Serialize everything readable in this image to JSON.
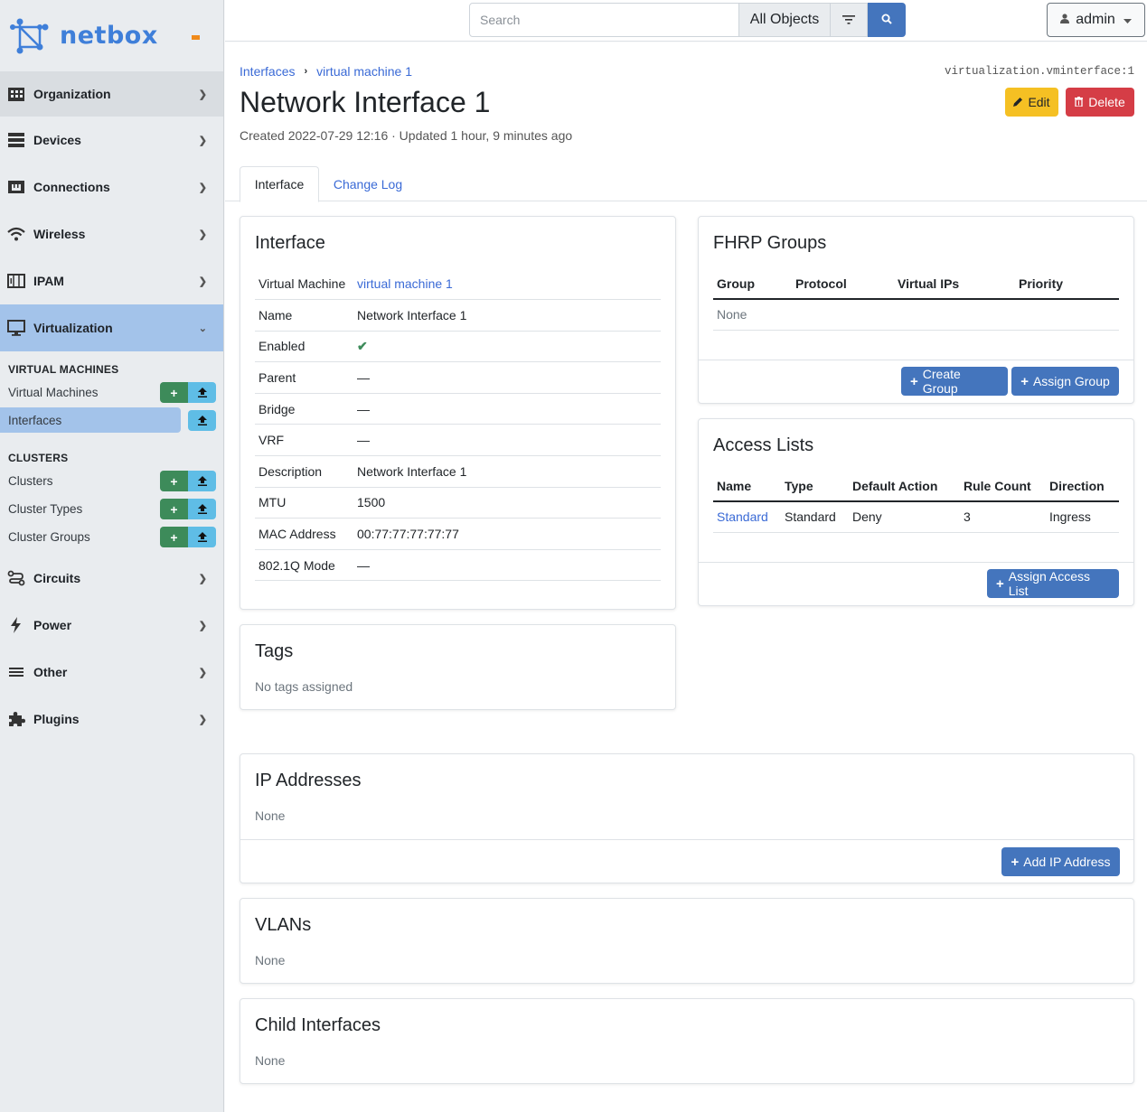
{
  "brand": {
    "name": "netbox"
  },
  "sidebar": {
    "sections_top": [
      {
        "label": "Organization",
        "icon": "building-icon"
      },
      {
        "label": "Devices",
        "icon": "server-icon"
      },
      {
        "label": "Connections",
        "icon": "ethernet-icon"
      },
      {
        "label": "Wireless",
        "icon": "wifi-icon"
      },
      {
        "label": "IPAM",
        "icon": "counter-icon"
      },
      {
        "label": "Virtualization",
        "icon": "monitor-icon"
      }
    ],
    "vm_heading": "VIRTUAL MACHINES",
    "vm_items": [
      {
        "label": "Virtual Machines"
      },
      {
        "label": "Interfaces"
      }
    ],
    "cluster_heading": "CLUSTERS",
    "cluster_items": [
      {
        "label": "Clusters"
      },
      {
        "label": "Cluster Types"
      },
      {
        "label": "Cluster Groups"
      }
    ],
    "sections_bottom": [
      {
        "label": "Circuits",
        "icon": "transit-icon"
      },
      {
        "label": "Power",
        "icon": "flash-icon"
      },
      {
        "label": "Other",
        "icon": "menu-icon"
      },
      {
        "label": "Plugins",
        "icon": "puzzle-icon"
      }
    ],
    "add_symbol": "+",
    "import_symbol": "⇪"
  },
  "topbar": {
    "search_placeholder": "Search",
    "object_selector": "All Objects",
    "user": "admin"
  },
  "header": {
    "breadcrumb": [
      "Interfaces",
      "virtual machine 1"
    ],
    "object_id": "virtualization.vminterface:1",
    "title": "Network Interface 1",
    "meta": "Created 2022-07-29 12:16 · Updated 1 hour, 9 minutes ago",
    "edit_label": "Edit",
    "delete_label": "Delete"
  },
  "tabs": [
    "Interface",
    "Change Log"
  ],
  "interface_card": {
    "title": "Interface",
    "rows": [
      {
        "key": "Virtual Machine",
        "value": "virtual machine 1"
      },
      {
        "key": "Name",
        "value": "Network Interface 1"
      },
      {
        "key": "Enabled",
        "value": "✔"
      },
      {
        "key": "Parent",
        "value": "—"
      },
      {
        "key": "Bridge",
        "value": "—"
      },
      {
        "key": "VRF",
        "value": "—"
      },
      {
        "key": "Description",
        "value": "Network Interface 1"
      },
      {
        "key": "MTU",
        "value": "1500"
      },
      {
        "key": "MAC Address",
        "value": "00:77:77:77:77:77"
      },
      {
        "key": "802.1Q Mode",
        "value": "—"
      }
    ]
  },
  "tags_card": {
    "title": "Tags",
    "empty": "No tags assigned"
  },
  "fhrp_card": {
    "title": "FHRP Groups",
    "columns": [
      "Group",
      "Protocol",
      "Virtual IPs",
      "Priority"
    ],
    "empty": "None",
    "create_label": "Create Group",
    "assign_label": "Assign Group"
  },
  "acl_card": {
    "title": "Access Lists",
    "columns": [
      "Name",
      "Type",
      "Default Action",
      "Rule Count",
      "Direction"
    ],
    "rows": [
      [
        "Standard",
        "Standard",
        "Deny",
        "3",
        "Ingress"
      ]
    ],
    "assign_label": "Assign Access List"
  },
  "ip_card": {
    "title": "IP Addresses",
    "empty": "None",
    "add_label": "Add IP Address"
  },
  "vlans_card": {
    "title": "VLANs",
    "empty": "None"
  },
  "child_card": {
    "title": "Child Interfaces",
    "empty": "None"
  },
  "colors": {
    "primary": "#4475bd",
    "success": "#3d8b5a",
    "warning": "#f5c023",
    "danger": "#d53d46",
    "sidebar_active": "#a3c3ea"
  }
}
